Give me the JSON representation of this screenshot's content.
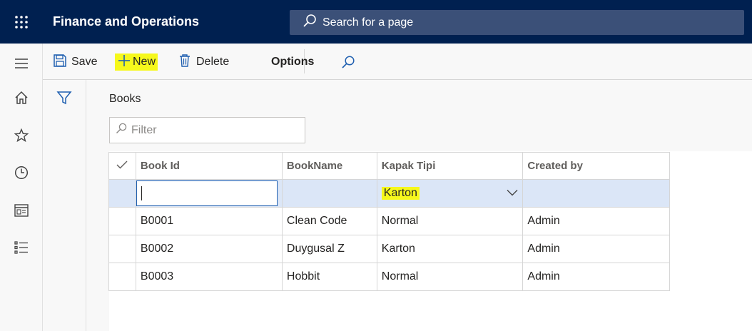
{
  "app": {
    "title": "Finance and Operations"
  },
  "search": {
    "placeholder": "Search for a page"
  },
  "nav": {
    "icons": [
      "menu-icon",
      "home-icon",
      "star-icon",
      "clock-icon",
      "workspace-icon",
      "list-icon"
    ]
  },
  "toolbar": {
    "save_label": "Save",
    "new_label": "New",
    "delete_label": "Delete",
    "options_label": "Options"
  },
  "page": {
    "caption": "Books",
    "filter_placeholder": "Filter"
  },
  "grid": {
    "columns": [
      "Book Id",
      "BookName",
      "Kapak Tipi",
      "Created by"
    ],
    "new_row": {
      "book_id": "",
      "book_name": "",
      "kapak_tipi": "Karton",
      "created_by": ""
    },
    "rows": [
      {
        "book_id": "B0001",
        "book_name": "Clean Code",
        "kapak_tipi": "Normal",
        "created_by": "Admin"
      },
      {
        "book_id": "B0002",
        "book_name": "Duygusal Z",
        "kapak_tipi": "Karton",
        "created_by": "Admin"
      },
      {
        "book_id": "B0003",
        "book_name": "Hobbit",
        "kapak_tipi": "Normal",
        "created_by": "Admin"
      }
    ]
  },
  "colors": {
    "topbar": "#002050",
    "search": "#3b5078",
    "highlight": "#f6f81c",
    "selected_row": "#dbe6f7"
  }
}
